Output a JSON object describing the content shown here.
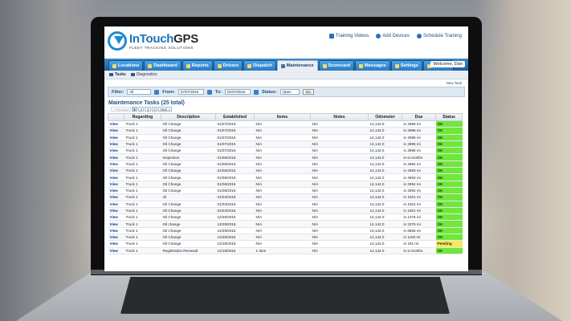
{
  "brand": {
    "name_a": "InTouch",
    "name_b": "GPS",
    "tagline": "FLEET TRACKING SOLUTIONS"
  },
  "top_links": [
    {
      "label": "Training Videos",
      "icon": "video-icon"
    },
    {
      "label": "Add Devices",
      "icon": "add-icon"
    },
    {
      "label": "Schedule Training",
      "icon": "calendar-icon"
    }
  ],
  "nav": {
    "tabs": [
      {
        "label": "Locations",
        "icon": "map-icon"
      },
      {
        "label": "Dashboard",
        "icon": "dashboard-icon"
      },
      {
        "label": "Reports",
        "icon": "report-icon"
      },
      {
        "label": "Drivers",
        "icon": "driver-icon"
      },
      {
        "label": "Dispatch",
        "icon": "dispatch-icon"
      },
      {
        "label": "Maintenance",
        "icon": "wrench-icon",
        "active": true
      },
      {
        "label": "Scorecard",
        "icon": "scorecard-icon"
      },
      {
        "label": "Messages",
        "icon": "mail-icon"
      },
      {
        "label": "Settings",
        "icon": "gear-icon"
      },
      {
        "label": "Support",
        "icon": "support-icon"
      }
    ],
    "welcome": "Welcome, Dan"
  },
  "subnav": {
    "tasks": "Tasks",
    "diagnostics": "Diagnostics"
  },
  "new_task": "New Task",
  "filter": {
    "filter_label": "Filter:",
    "filter_value": "All",
    "from_label": "From:",
    "from_value": "07/07/2015",
    "to_label": "To:",
    "to_value": "01/07/2016",
    "status_label": "Status:",
    "status_value": "Open",
    "go_label": "Go"
  },
  "section_title": "Maintenance Tasks (25 total)",
  "pager": {
    "prev": "« Previous",
    "pages": [
      "1",
      "2",
      "3",
      "4"
    ],
    "next": "Next »"
  },
  "table": {
    "columns": [
      "",
      "Regarding",
      "Description",
      "Established",
      "Items",
      "Notes",
      "Odometer",
      "Due",
      "Status"
    ],
    "rows": [
      [
        "View",
        "Truck 1",
        "Oil Change",
        "01/07/2016",
        "N/A",
        "N/A",
        "14,142.0",
        "in 2996 mi",
        "OK"
      ],
      [
        "View",
        "Truck 1",
        "Oil Change",
        "01/07/2016",
        "N/A",
        "N/A",
        "14,142.0",
        "in 2996 mi",
        "OK"
      ],
      [
        "View",
        "Truck 1",
        "Oil Change",
        "01/07/2016",
        "N/A",
        "N/A",
        "14,142.0",
        "in 2996 mi",
        "OK"
      ],
      [
        "View",
        "Truck 1",
        "Oil Change",
        "01/07/2016",
        "N/A",
        "N/A",
        "14,142.0",
        "in 2996 mi",
        "OK"
      ],
      [
        "View",
        "Truck 1",
        "Oil Change",
        "01/07/2016",
        "N/A",
        "N/A",
        "14,142.0",
        "in 2996 mi",
        "OK"
      ],
      [
        "View",
        "Truck 1",
        "Inspection",
        "01/06/2016",
        "N/A",
        "N/A",
        "14,142.0",
        "in 6 months",
        "OK"
      ],
      [
        "View",
        "Truck 1",
        "Oil Change",
        "01/06/2016",
        "N/A",
        "N/A",
        "14,142.0",
        "in 2994 mi",
        "OK"
      ],
      [
        "View",
        "Truck 1",
        "Oil Change",
        "01/06/2016",
        "N/A",
        "N/A",
        "14,142.0",
        "in 2993 mi",
        "OK"
      ],
      [
        "View",
        "Truck 1",
        "Oil Change",
        "01/06/2016",
        "N/A",
        "N/A",
        "14,142.0",
        "in 4993 mi",
        "OK"
      ],
      [
        "View",
        "Truck 1",
        "Oil Change",
        "01/06/2016",
        "N/A",
        "N/A",
        "14,142.0",
        "in 2994 mi",
        "OK"
      ],
      [
        "View",
        "Truck 1",
        "Oil Change",
        "01/06/2016",
        "N/A",
        "N/A",
        "14,142.0",
        "in 2994 mi",
        "OK"
      ],
      [
        "View",
        "Truck 1",
        "oil",
        "01/04/2016",
        "N/A",
        "N/A",
        "14,142.0",
        "in 1601 mi",
        "OK"
      ],
      [
        "View",
        "Truck 1",
        "Oil Change",
        "01/04/2016",
        "N/A",
        "N/A",
        "14,142.0",
        "in 1601 mi",
        "OK"
      ],
      [
        "View",
        "Truck 1",
        "Oil Change",
        "01/04/2016",
        "N/A",
        "N/A",
        "14,142.0",
        "in 1601 mi",
        "OK"
      ],
      [
        "View",
        "Truck 1",
        "Oil Change",
        "12/29/2015",
        "N/A",
        "N/A",
        "14,142.0",
        "in 1376 mi",
        "OK"
      ],
      [
        "View",
        "Truck 1",
        "Oil change",
        "12/29/2015",
        "N/A",
        "N/A",
        "14,142.0",
        "in 3376 mi",
        "OK"
      ],
      [
        "View",
        "Truck 1",
        "Oil Change",
        "12/29/2015",
        "N/A",
        "N/A",
        "14,142.0",
        "in 6665 mi",
        "OK"
      ],
      [
        "View",
        "Truck 1",
        "Oil Change",
        "12/28/2015",
        "N/A",
        "N/A",
        "14,142.0",
        "in 1193 mi",
        "OK"
      ],
      [
        "View",
        "Truck 1",
        "Oil Change",
        "12/18/2015",
        "N/A",
        "N/A",
        "14,142.0",
        "in 191 mi",
        "Pending"
      ],
      [
        "View",
        "Truck 1",
        "Registration Renewal",
        "12/18/2015",
        "1 Item",
        "N/A",
        "14,142.0",
        "in 5 months",
        "OK"
      ]
    ]
  },
  "colors": {
    "ok": "#6fe83a",
    "pending": "#f5ea5a",
    "nav": "#2b7cc3"
  }
}
